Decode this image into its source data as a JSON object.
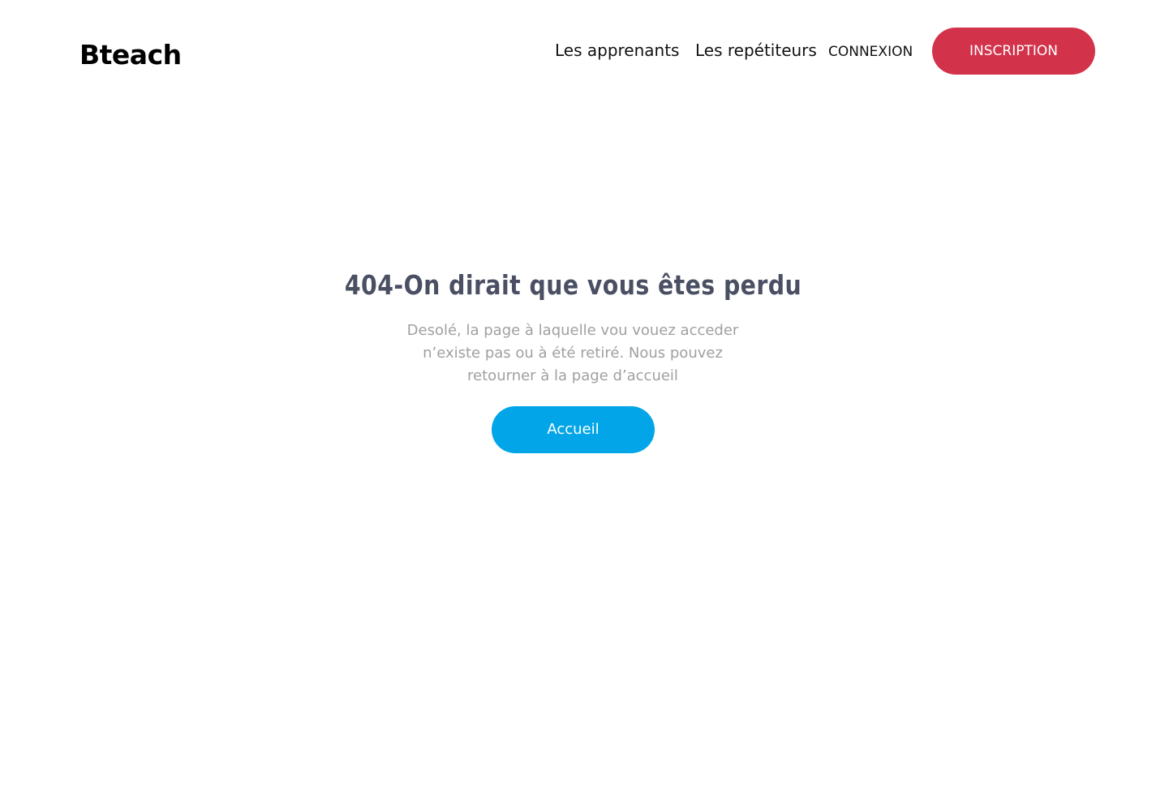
{
  "header": {
    "logo_text": "Bteach",
    "nav": {
      "learners_label": "Les apprenants",
      "tutors_label": "Les repétiteurs",
      "login_label": "CONNEXION",
      "signup_label": "INSCRIPTION"
    }
  },
  "main": {
    "title": "404-On dirait que vous êtes perdu",
    "description_lines": [
      "Desolé, la page à laquelle vou vouez acceder",
      "n’existe pas ou à été retiré. Nous pouvez",
      "retourner à la page d’accueil"
    ],
    "home_button_label": "Accueil"
  },
  "colors": {
    "brand_red": "#d3324b",
    "primary_blue": "#02a6e8",
    "title_text": "#4a4f63",
    "muted_text": "#a0a0a0"
  }
}
